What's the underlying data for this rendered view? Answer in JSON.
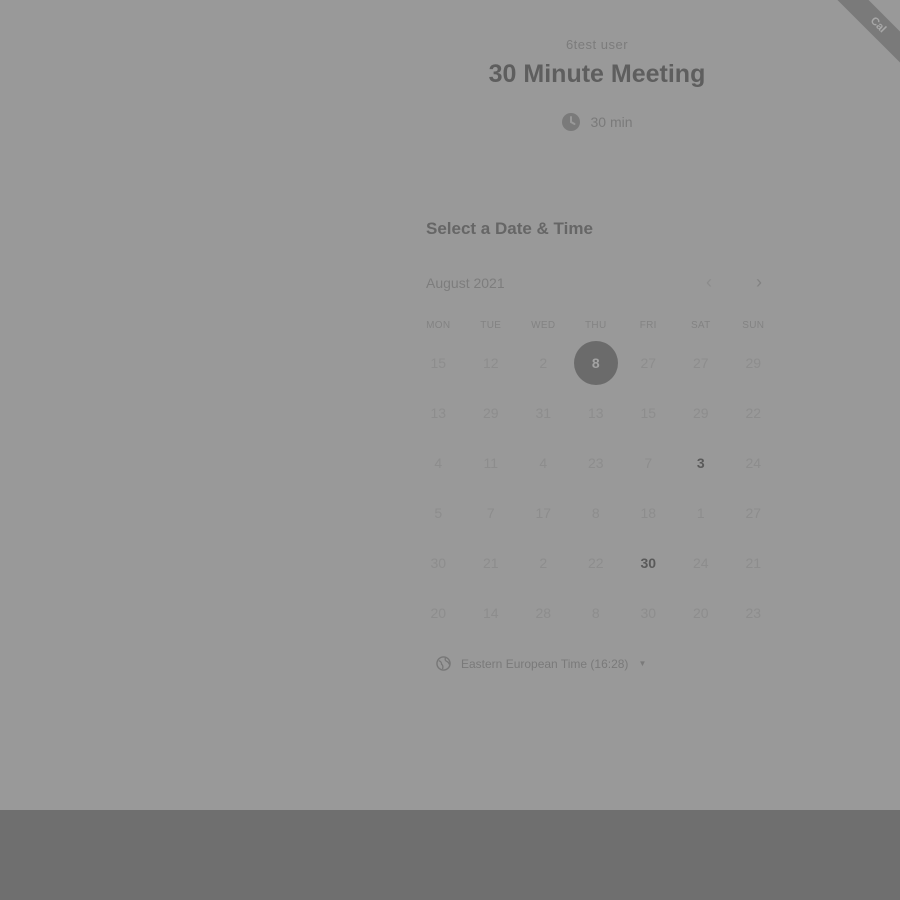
{
  "event": {
    "owner": "6test user",
    "title": "30 Minute Meeting",
    "duration": "30 min"
  },
  "calendar": {
    "heading": "Select a Date & Time",
    "month": "August 2021",
    "weekdays": [
      "MON",
      "TUE",
      "WED",
      "THU",
      "FRI",
      "SAT",
      "SUN"
    ],
    "rows": [
      [
        "15",
        "12",
        "2",
        "8",
        "27",
        "27",
        "29"
      ],
      [
        "13",
        "29",
        "31",
        "13",
        "15",
        "29",
        "22"
      ],
      [
        "4",
        "11",
        "4",
        "23",
        "7",
        "3",
        "24"
      ],
      [
        "5",
        "7",
        "17",
        "8",
        "18",
        "1",
        "27"
      ],
      [
        "30",
        "21",
        "2",
        "22",
        "30",
        "24",
        "21"
      ],
      [
        "20",
        "14",
        "28",
        "8",
        "30",
        "20",
        "23"
      ]
    ],
    "selected": "8",
    "available": [
      "3",
      "30"
    ]
  },
  "timezone": {
    "label": "Eastern European Time (16:28)"
  },
  "ribbon": {
    "text": "Cal"
  },
  "colors": {
    "overlay": "#999999",
    "footer": "#6f6f6f",
    "selected_day": "#6b6b6b"
  }
}
